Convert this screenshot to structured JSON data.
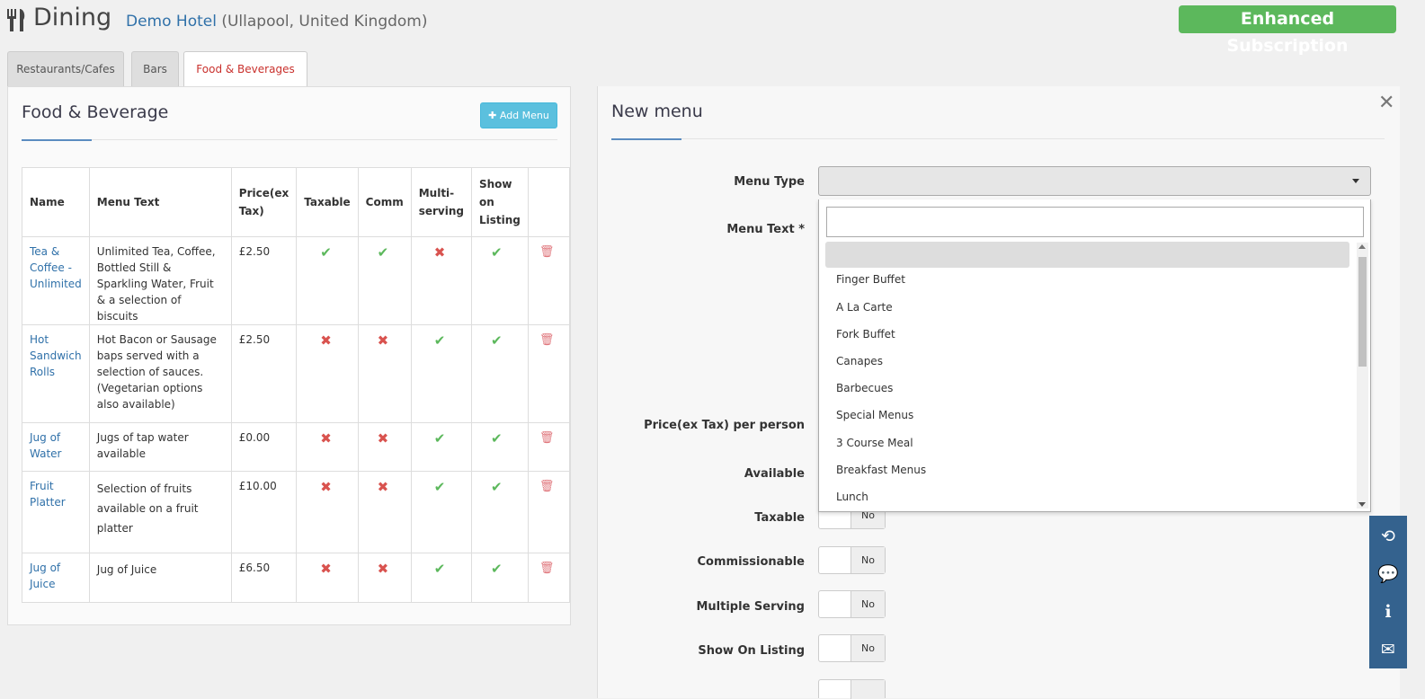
{
  "header": {
    "title": "Dining",
    "hotel_name": "Demo Hotel",
    "location": "(Ullapool, United Kingdom)",
    "subscription": "Enhanced Subscription",
    "subscription_color": "#5cb85c"
  },
  "tabs": [
    {
      "label": "Restaurants/Cafes",
      "active": false
    },
    {
      "label": "Bars",
      "active": false
    },
    {
      "label": "Food & Beverages",
      "active": true
    }
  ],
  "left_panel": {
    "title": "Food & Beverage",
    "add_button": "Add Menu",
    "columns": [
      "Name",
      "Menu Text",
      "Price(ex Tax)",
      "Taxable",
      "Comm",
      "Multi-serving",
      "Show on Listing",
      ""
    ],
    "rows": [
      {
        "name": "Tea & Coffee - Unlimited",
        "text": "Unlimited Tea, Coffee, Bottled Still & Sparkling Water, Fruit & a selection of biscuits",
        "price": "£2.50",
        "taxable": true,
        "comm": true,
        "multi": false,
        "listing": true
      },
      {
        "name": "Hot Sandwich Rolls",
        "text": "Hot Bacon or Sausage baps served with a selection of sauces. (Vegetarian options also available)",
        "price": "£2.50",
        "taxable": false,
        "comm": false,
        "multi": true,
        "listing": true
      },
      {
        "name": "Jug of Water",
        "text": "Jugs of tap water available",
        "price": "£0.00",
        "taxable": false,
        "comm": false,
        "multi": true,
        "listing": true
      },
      {
        "name": "Fruit Platter",
        "text": "Selection of fruits available on a fruit platter",
        "price": "£10.00",
        "taxable": false,
        "comm": false,
        "multi": true,
        "listing": true
      },
      {
        "name": "Jug of Juice",
        "text": "Jug of Juice",
        "price": "£6.50",
        "taxable": false,
        "comm": false,
        "multi": true,
        "listing": true
      }
    ]
  },
  "right_panel": {
    "title": "New menu",
    "labels": {
      "menu_type": "Menu Type",
      "menu_text": "Menu Text *",
      "price": "Price(ex Tax) per person",
      "available": "Available",
      "taxable": "Taxable",
      "commissionable": "Commissionable",
      "multiple_serving": "Multiple Serving",
      "show_on_listing": "Show On Listing"
    },
    "toggle_off": "No",
    "dropdown_options": [
      "",
      "Finger Buffet",
      "A La Carte",
      "Fork Buffet",
      "Canapes",
      "Barbecues",
      "Special Menus",
      "3 Course Meal",
      "Breakfast Menus",
      "Lunch"
    ]
  }
}
